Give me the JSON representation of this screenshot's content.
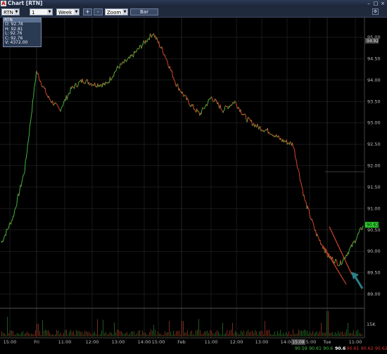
{
  "window": {
    "title": "Chart [RTN]",
    "logo_glyph": "A"
  },
  "toolbar": {
    "symbol": "RTN",
    "interval": "1 minute",
    "range": "Week",
    "plus_label": "+",
    "minus_label": "-",
    "zoom_label": "Zoom",
    "bar_label": "Bar"
  },
  "infobox": {
    "header": "RTN",
    "open": "O: 92.78",
    "high": "H: 92.81",
    "low": "L: 92.76",
    "close": "C: 92.76",
    "volume": "V: 4372.00"
  },
  "price_axis": {
    "ticks": [
      "95.00",
      "94.50",
      "94.00",
      "93.50",
      "93.00",
      "92.50",
      "92.00",
      "91.50",
      "91.00",
      "90.50",
      "90.00",
      "89.50",
      "89.00"
    ],
    "marker_prev": "94.92",
    "marker_current": "90.62"
  },
  "volume_axis": {
    "label": "15K"
  },
  "time_axis": {
    "labels": [
      "15:00",
      "Fri",
      "11:00",
      "12:00",
      "13:00",
      "14:00",
      "15:00",
      "Feb",
      "11:00",
      "12:00",
      "13:00",
      "14:00",
      "15:00",
      "Tue",
      "11:00"
    ],
    "highlight": "15:08"
  },
  "status_quotes": [
    {
      "text": "90.59",
      "color": "#3fbf3f"
    },
    {
      "text": "90.61",
      "color": "#3fbf3f"
    },
    {
      "text": "90.6",
      "color": "#3fbf3f"
    },
    {
      "text": "90.6",
      "color": "#ffffff"
    },
    {
      "text": "90.61",
      "color": "#e03030"
    },
    {
      "text": "90.62",
      "color": "#e03030"
    },
    {
      "text": "90.62",
      "color": "#e03030"
    },
    {
      "text": "90.62",
      "color": "#ffffff"
    }
  ],
  "colors": {
    "up": "#3cb53c",
    "down": "#d9452b",
    "mid": "#e2a020",
    "grid": "#2f2f2f",
    "trend": "#d2452a",
    "arrow": "#2d7f86"
  },
  "chart_data": {
    "type": "line",
    "title": "",
    "xlabel": "",
    "ylabel": "",
    "ylim": [
      88.75,
      95.35
    ],
    "x": [
      "Thu 15:00",
      "Thu 15:30",
      "Fri 10:00",
      "Fri 10:30",
      "Fri 11:00",
      "Fri 11:30",
      "Fri 12:00",
      "Fri 12:30",
      "Fri 13:00",
      "Fri 13:30",
      "Fri 14:00",
      "Fri 14:30",
      "Fri 15:00",
      "Fri 15:30",
      "Mon 10:00",
      "Mon 10:30",
      "Mon 11:00",
      "Mon 11:30",
      "Mon 12:00",
      "Mon 12:30",
      "Mon 13:00",
      "Mon 13:30",
      "Mon 14:00",
      "Mon 14:30",
      "Mon 15:00",
      "Mon 15:30",
      "Tue 10:00",
      "Tue 10:15",
      "Tue 10:30",
      "Tue 10:45",
      "Tue 11:00",
      "Tue 11:15"
    ],
    "series": [
      {
        "name": "",
        "values": [
          90.2,
          90.8,
          91.9,
          94.2,
          93.6,
          93.3,
          93.8,
          94.0,
          93.9,
          93.9,
          94.3,
          94.5,
          94.8,
          95.1,
          94.6,
          93.9,
          93.5,
          93.2,
          93.6,
          93.3,
          93.5,
          93.1,
          92.9,
          92.8,
          92.6,
          92.5,
          91.2,
          90.4,
          89.9,
          89.7,
          90.1,
          90.6
        ]
      }
    ],
    "volume_label": "15K"
  }
}
